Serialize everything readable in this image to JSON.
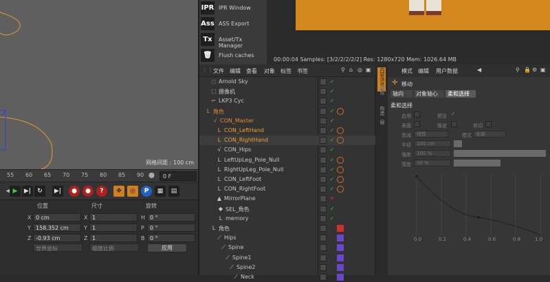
{
  "viewport": {
    "grid_spacing": "网格间距 : 100 cm"
  },
  "timeline": {
    "ticks": [
      "55",
      "60",
      "65",
      "70",
      "75",
      "80",
      "85",
      "90"
    ],
    "frame": "0 F"
  },
  "coords": {
    "headers": {
      "position": "位置",
      "size": "尺寸",
      "rotation": "旋转"
    },
    "rows": [
      {
        "axis": "X",
        "pos": "0 cm",
        "size_axis": "X",
        "size": "1",
        "rot_axis": "H",
        "rot": "0 °"
      },
      {
        "axis": "Y",
        "pos": "158.352 cm",
        "size_axis": "Y",
        "size": "1",
        "rot_axis": "P",
        "rot": "0 °"
      },
      {
        "axis": "Z",
        "pos": "-0.93 cm",
        "size_axis": "Z",
        "size": "1",
        "rot_axis": "B",
        "rot": "0 °"
      }
    ],
    "world_select": "世界坐标",
    "scale_select": "缩放比例",
    "apply": "应用"
  },
  "tool_menu": [
    {
      "icon": "IPR",
      "label": "IPR Window"
    },
    {
      "icon": "Ass",
      "label": "ASS Export"
    },
    {
      "icon": "Tx",
      "label": "Asset/Tx Manager"
    },
    {
      "icon": "trash-icon",
      "label": "Flush caches"
    }
  ],
  "render": {
    "status": "00:00:04  Samples: [3/2/2/2/2/2]  Res: 1280x720  Mem: 1026.64 MB"
  },
  "object_manager": {
    "menu": [
      "文件",
      "编辑",
      "查看",
      "对象",
      "标签",
      "书签"
    ],
    "rows": [
      {
        "name": "Arnold Sky",
        "color": "#c8c8c8"
      },
      {
        "name": "摄像机",
        "color": "#c8c8c8"
      },
      {
        "name": "LKP3 Cyc",
        "color": "#c8c8c8"
      },
      {
        "name": "角色",
        "color": "#e0883a"
      },
      {
        "name": "CON_Master",
        "color": "#e0883a"
      },
      {
        "name": "CON_LeftHand",
        "color": "#f0a030"
      },
      {
        "name": "CON_RightHand",
        "color": "#f0a030"
      },
      {
        "name": "CON_Hips",
        "color": "#c8c8c8"
      },
      {
        "name": "LeftUpLeg_Pole_Null",
        "color": "#c8c8c8"
      },
      {
        "name": "RightUpLeg_Pole_Null",
        "color": "#c8c8c8"
      },
      {
        "name": "CON_LeftFoot",
        "color": "#c8c8c8"
      },
      {
        "name": "CON_RightFoot",
        "color": "#c8c8c8"
      },
      {
        "name": "MirrorPlane",
        "color": "#c8c8c8"
      },
      {
        "name": "SEL_角色",
        "color": "#c8c8c8"
      },
      {
        "name": "memory",
        "color": "#c8c8c8"
      },
      {
        "name": "角色",
        "color": "#c8c8c8"
      },
      {
        "name": "Hips",
        "color": "#c8c8c8"
      },
      {
        "name": "Spine",
        "color": "#c8c8c8"
      },
      {
        "name": "Spine1",
        "color": "#c8c8c8"
      },
      {
        "name": "Spine2",
        "color": "#c8c8c8"
      },
      {
        "name": "Neck",
        "color": "#c8c8c8"
      }
    ]
  },
  "vertical_tabs": [
    "内容浏览器",
    "属性",
    "构造",
    "层"
  ],
  "attribute_manager": {
    "menu": [
      "模式",
      "编辑",
      "用户数据"
    ],
    "title": "移动",
    "tabs": [
      "轴向",
      "对象轴心",
      "柔和选择"
    ],
    "section": "柔和选择",
    "enable": "启用",
    "preview": "预览",
    "surface": "表面",
    "rubber": "橡皮",
    "clip": "剪切",
    "falloff_mode": "衰减",
    "falloff_value": "线性",
    "mode": "模式",
    "mode_value": "全部",
    "radius": "半径",
    "radius_value": "100 cm",
    "strength": "强度",
    "strength_value": "100 %",
    "width": "宽度",
    "width_value": "50 %",
    "x_ticks": [
      "0.0",
      "0.2",
      "0.4",
      "0.6",
      "0.8",
      "1.0"
    ]
  }
}
